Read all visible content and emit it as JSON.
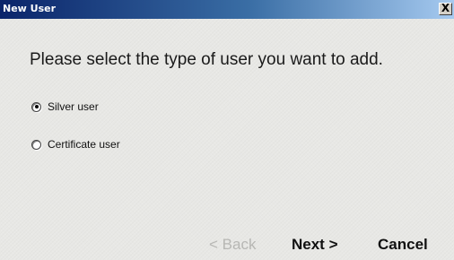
{
  "window": {
    "title": "New User",
    "close_glyph": "X"
  },
  "dialog": {
    "instruction": "Please select the type of user you want to add.",
    "options": [
      {
        "label": "Silver user",
        "selected": true
      },
      {
        "label": "Certificate user",
        "selected": false
      }
    ]
  },
  "buttons": {
    "back": "< Back",
    "next": "Next >",
    "cancel": "Cancel"
  },
  "colors": {
    "titlebar_start": "#0a246a",
    "titlebar_end": "#a6caf0",
    "disabled_text": "#b7b7b4"
  }
}
